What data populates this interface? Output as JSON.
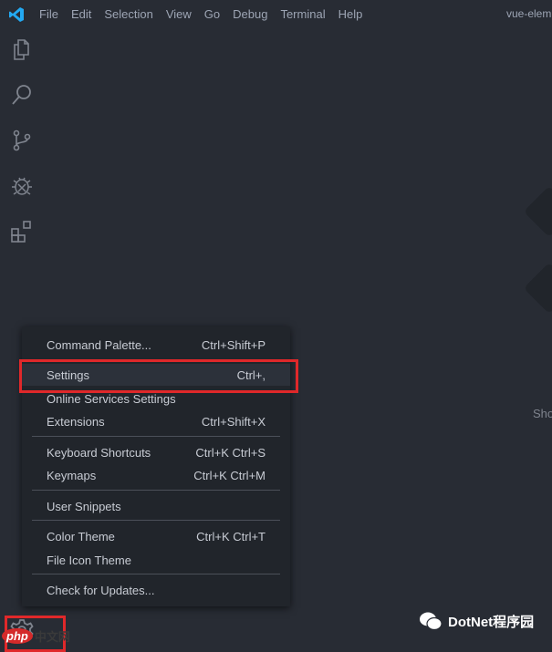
{
  "titlebar": {
    "menus": [
      "File",
      "Edit",
      "Selection",
      "View",
      "Go",
      "Debug",
      "Terminal",
      "Help"
    ],
    "window_title": "vue-elem"
  },
  "activity_bar": {
    "icons": [
      "files-icon",
      "search-icon",
      "source-control-icon",
      "debug-icon",
      "extensions-icon"
    ]
  },
  "editor": {
    "partial_text": "Sho"
  },
  "context_menu": {
    "items": [
      {
        "label": "Command Palette...",
        "shortcut": "Ctrl+Shift+P"
      },
      {
        "label": "Settings",
        "shortcut": "Ctrl+,"
      },
      {
        "label": "Online Services Settings",
        "shortcut": ""
      },
      {
        "label": "Extensions",
        "shortcut": "Ctrl+Shift+X"
      },
      {
        "label": "Keyboard Shortcuts",
        "shortcut": "Ctrl+K Ctrl+S"
      },
      {
        "label": "Keymaps",
        "shortcut": "Ctrl+K Ctrl+M"
      },
      {
        "label": "User Snippets",
        "shortcut": ""
      },
      {
        "label": "Color Theme",
        "shortcut": "Ctrl+K Ctrl+T"
      },
      {
        "label": "File Icon Theme",
        "shortcut": ""
      },
      {
        "label": "Check for Updates...",
        "shortcut": ""
      }
    ]
  },
  "watermarks": {
    "wechat": "DotNet程序园",
    "php_logo": "php",
    "php_text": "中文网"
  },
  "colors": {
    "background": "#282c34",
    "menu": "#21252b",
    "highlight": "#e0282a",
    "accent": "#23a9f2"
  }
}
